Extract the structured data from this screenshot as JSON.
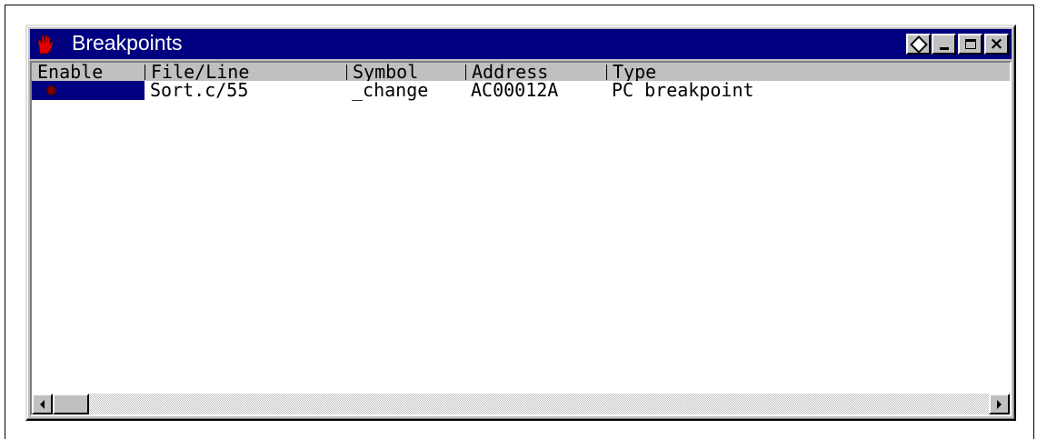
{
  "window": {
    "title": "Breakpoints",
    "buttons": {
      "pin": "pin-icon",
      "minimize": "minimize-icon",
      "maximize": "maximize-icon",
      "close": "close-icon"
    }
  },
  "columns": [
    "Enable",
    "File/Line",
    "Symbol",
    "Address",
    "Type"
  ],
  "rows": [
    {
      "enable": "breakpoint-dot-icon",
      "file_line": "Sort.c/55",
      "symbol": "_change",
      "address": "AC00012A",
      "type": "PC breakpoint"
    }
  ],
  "scrollbar": {
    "position": 0
  },
  "colors": {
    "titlebar": "#000080",
    "face": "#c0c0c0",
    "selection": "#000080",
    "breakpoint": "#7a0000"
  }
}
